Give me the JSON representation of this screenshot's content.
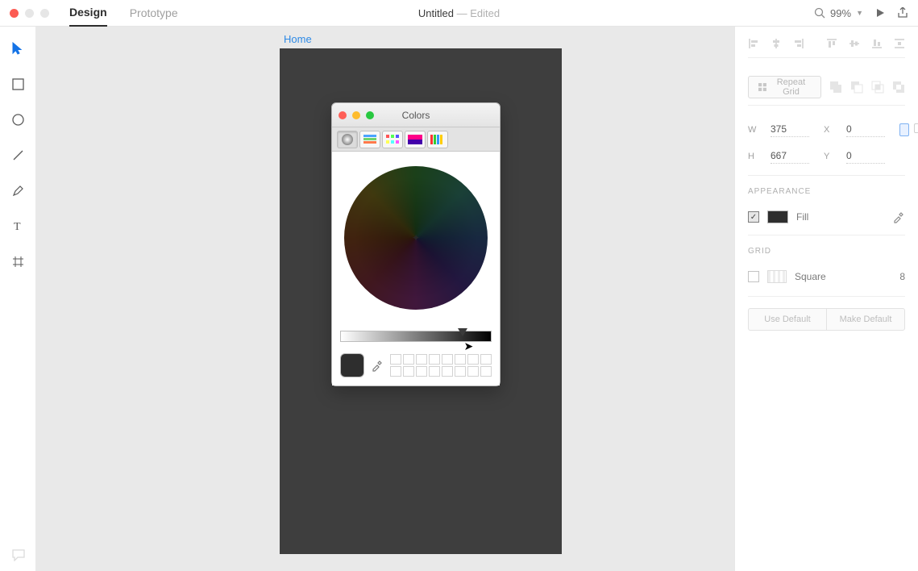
{
  "topbar": {
    "tabs": {
      "design": "Design",
      "prototype": "Prototype"
    },
    "title": "Untitled",
    "edited_suffix": " — Edited",
    "zoom": "99%"
  },
  "artboard": {
    "label": "Home"
  },
  "colors_panel": {
    "title": "Colors"
  },
  "panel": {
    "repeat_grid": "Repeat Grid",
    "fields": {
      "w_label": "W",
      "w": "375",
      "x_label": "X",
      "x": "0",
      "h_label": "H",
      "h": "667",
      "y_label": "Y",
      "y": "0"
    },
    "appearance_label": "APPEARANCE",
    "fill_label": "Fill",
    "grid_label": "GRID",
    "grid_type": "Square",
    "grid_value": "8",
    "use_default": "Use Default",
    "make_default": "Make Default"
  }
}
